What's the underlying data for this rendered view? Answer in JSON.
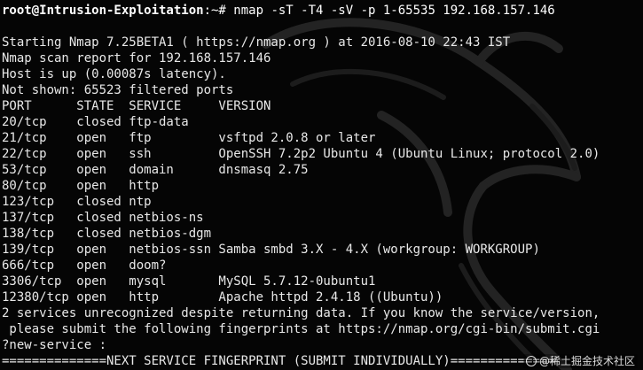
{
  "terminal": {
    "prompt": {
      "user_host": "root@Intrusion-Exploitation",
      "path": ":~#",
      "command": " nmap -sT -T4 -sV -p 1-65535 192.168.157.146"
    },
    "output": [
      "",
      "Starting Nmap 7.25BETA1 ( https://nmap.org ) at 2016-08-10 22:43 IST",
      "Nmap scan report for 192.168.157.146",
      "Host is up (0.00087s latency).",
      "Not shown: 65523 filtered ports",
      "PORT      STATE  SERVICE     VERSION",
      "20/tcp    closed ftp-data",
      "21/tcp    open   ftp         vsftpd 2.0.8 or later",
      "22/tcp    open   ssh         OpenSSH 7.2p2 Ubuntu 4 (Ubuntu Linux; protocol 2.0)",
      "53/tcp    open   domain      dnsmasq 2.75",
      "80/tcp    open   http",
      "123/tcp   closed ntp",
      "137/tcp   closed netbios-ns",
      "138/tcp   closed netbios-dgm",
      "139/tcp   open   netbios-ssn Samba smbd 3.X - 4.X (workgroup: WORKGROUP)",
      "666/tcp   open   doom?",
      "3306/tcp  open   mysql       MySQL 5.7.12-0ubuntu1",
      "12380/tcp open   http        Apache httpd 2.4.18 ((Ubuntu))",
      "2 services unrecognized despite returning data. If you know the service/version,",
      " please submit the following fingerprints at https://nmap.org/cgi-bin/submit.cgi",
      "?new-service :",
      "==============NEXT SERVICE FINGERPRINT (SUBMIT INDIVIDUALLY)=============="
    ]
  },
  "watermark": {
    "text": "@稀土掘金技术社区"
  },
  "wallpaper": {
    "icon": "kali-dragon-icon",
    "color": "#2a2a2a"
  }
}
